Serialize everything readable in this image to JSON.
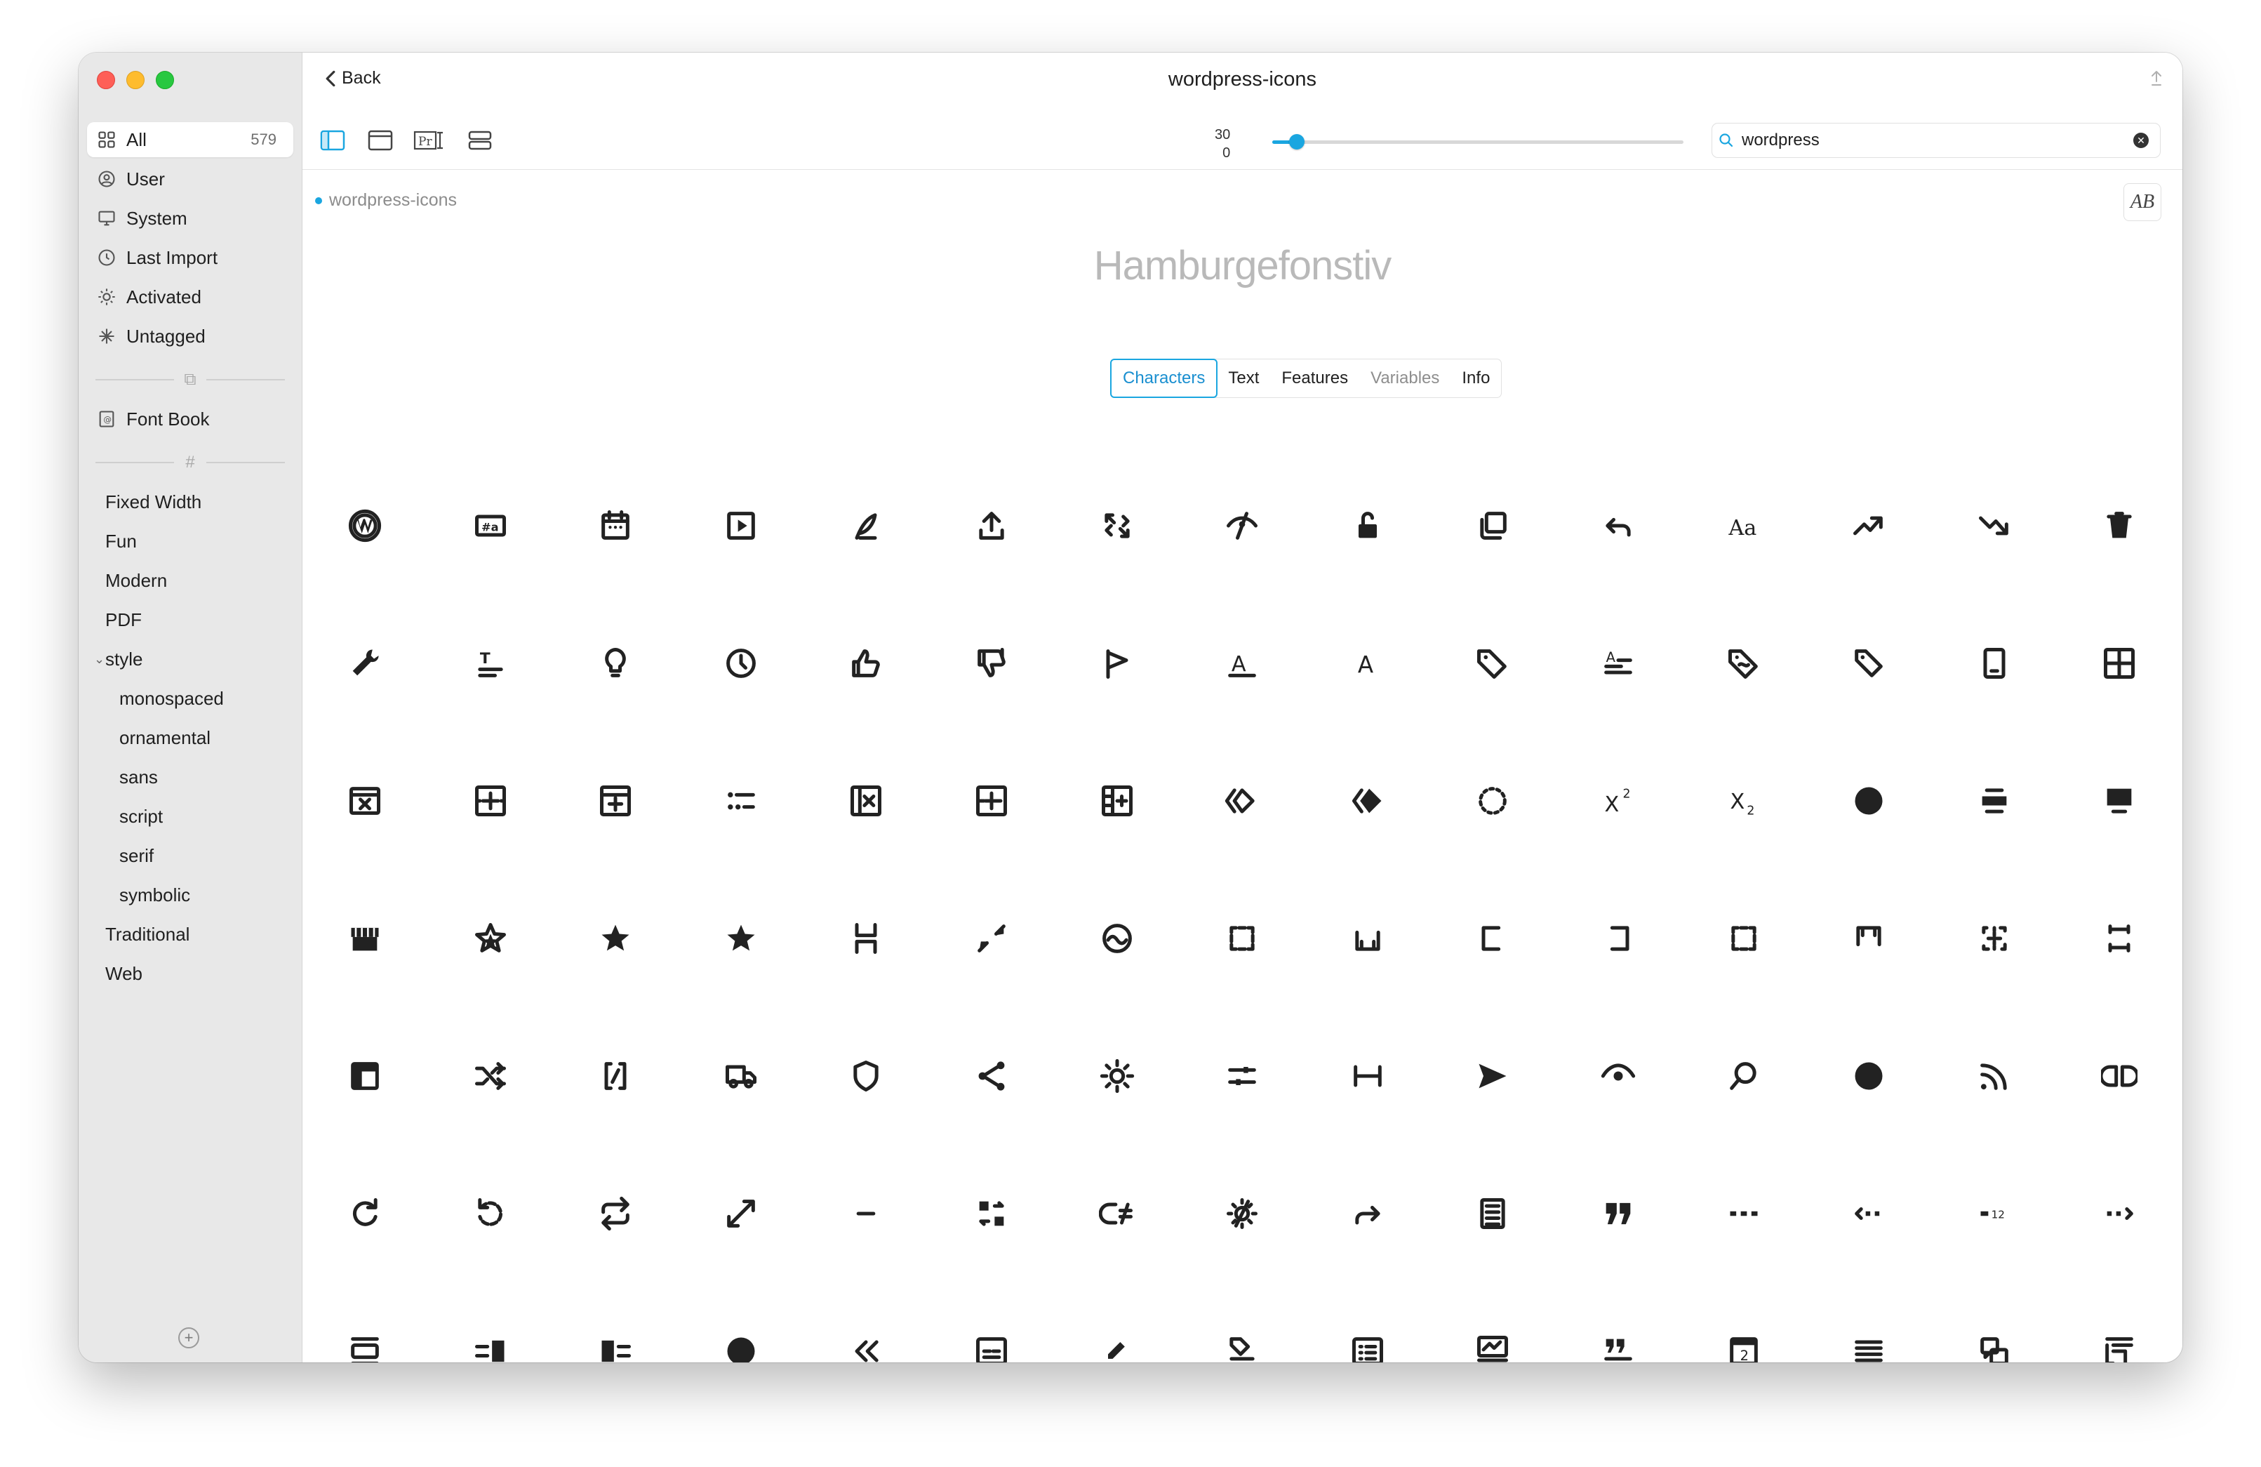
{
  "window": {
    "title": "wordpress-icons"
  },
  "sidebar": {
    "library": [
      {
        "label": "All",
        "count": "579",
        "icon": "grid-icon"
      },
      {
        "label": "User",
        "icon": "user-icon"
      },
      {
        "label": "System",
        "icon": "monitor-icon"
      },
      {
        "label": "Last Import",
        "icon": "clock-icon"
      },
      {
        "label": "Activated",
        "icon": "sun-icon"
      },
      {
        "label": "Untagged",
        "icon": "sparkle-icon"
      }
    ],
    "collections": [
      {
        "label": "Font Book",
        "icon": "font-book-icon"
      }
    ],
    "tags": [
      {
        "label": "Fixed Width",
        "level": 0
      },
      {
        "label": "Fun",
        "level": 0
      },
      {
        "label": "Modern",
        "level": 0
      },
      {
        "label": "PDF",
        "level": 0
      },
      {
        "label": "style",
        "level": 0,
        "expanded": true
      },
      {
        "label": "monospaced",
        "level": 1
      },
      {
        "label": "ornamental",
        "level": 1
      },
      {
        "label": "sans",
        "level": 1
      },
      {
        "label": "script",
        "level": 1
      },
      {
        "label": "serif",
        "level": 1
      },
      {
        "label": "symbolic",
        "level": 1
      },
      {
        "label": "Traditional",
        "level": 0
      },
      {
        "label": "Web",
        "level": 0
      }
    ]
  },
  "toolbar": {
    "back_label": "Back",
    "size_max": "30",
    "size_min": "0",
    "size_value_fraction": 0.06,
    "search_value": "wordpress",
    "search_placeholder": "Search"
  },
  "content": {
    "breadcrumb": "wordpress-icons",
    "preview_text": "Hamburgefonstiv",
    "tabs": [
      {
        "label": "Characters",
        "active": true,
        "enabled": true
      },
      {
        "label": "Text",
        "active": false,
        "enabled": true
      },
      {
        "label": "Features",
        "active": false,
        "enabled": true
      },
      {
        "label": "Variables",
        "active": false,
        "enabled": false
      },
      {
        "label": "Info",
        "active": false,
        "enabled": true
      }
    ],
    "glyphs": [
      [
        "wordpress",
        "hashtag-a",
        "calendar",
        "play-box",
        "feather",
        "upload",
        "resize-arrows",
        "hidden-eye",
        "lock-open",
        "duplicate",
        "undo",
        "text-aa",
        "trending-up",
        "trending-down",
        "trash"
      ],
      [
        "wrench",
        "text-title",
        "lightbulb",
        "clock",
        "thumbs-up",
        "thumbs-down",
        "flag",
        "underline-a",
        "letter-a",
        "tag",
        "heading-lines",
        "tag-swirl",
        "tag-outline",
        "tablet",
        "table"
      ],
      [
        "table-remove",
        "table-add",
        "table-column-add",
        "list-dots",
        "column-remove",
        "row-add",
        "cells-add",
        "diamond-outline",
        "diamond-filled",
        "dotted-circle",
        "superscript",
        "subscript",
        "circle-filled",
        "align-center",
        "block-top"
      ],
      [
        "store",
        "star-half",
        "star-filled",
        "star-filled-2",
        "stack",
        "shrink",
        "smiley",
        "frame-center",
        "frame-bottom",
        "frame-left",
        "frame-right",
        "frame-full",
        "frame-top",
        "frame-middle",
        "frame-all"
      ],
      [
        "layout",
        "shuffle",
        "shortcode",
        "truck",
        "shield",
        "share",
        "sun",
        "sliders",
        "width",
        "send",
        "eye",
        "search",
        "circle-filled-2",
        "rss",
        "columns-gap"
      ],
      [
        "rotate-right",
        "rotate-left",
        "repeat",
        "expand",
        "minus",
        "swap-boxes",
        "formula",
        "sun-off",
        "redo",
        "page",
        "quote",
        "more",
        "more-left",
        "more-numbers",
        "more-right"
      ],
      [
        "media-box",
        "align-right",
        "align-left",
        "circle-filled-3",
        "chevrons-left",
        "card",
        "pen-underline",
        "marker-underline",
        "list-box",
        "chart-box",
        "quote-lines",
        "calendar-2",
        "justify",
        "speech-boxes",
        "text-box"
      ]
    ]
  }
}
